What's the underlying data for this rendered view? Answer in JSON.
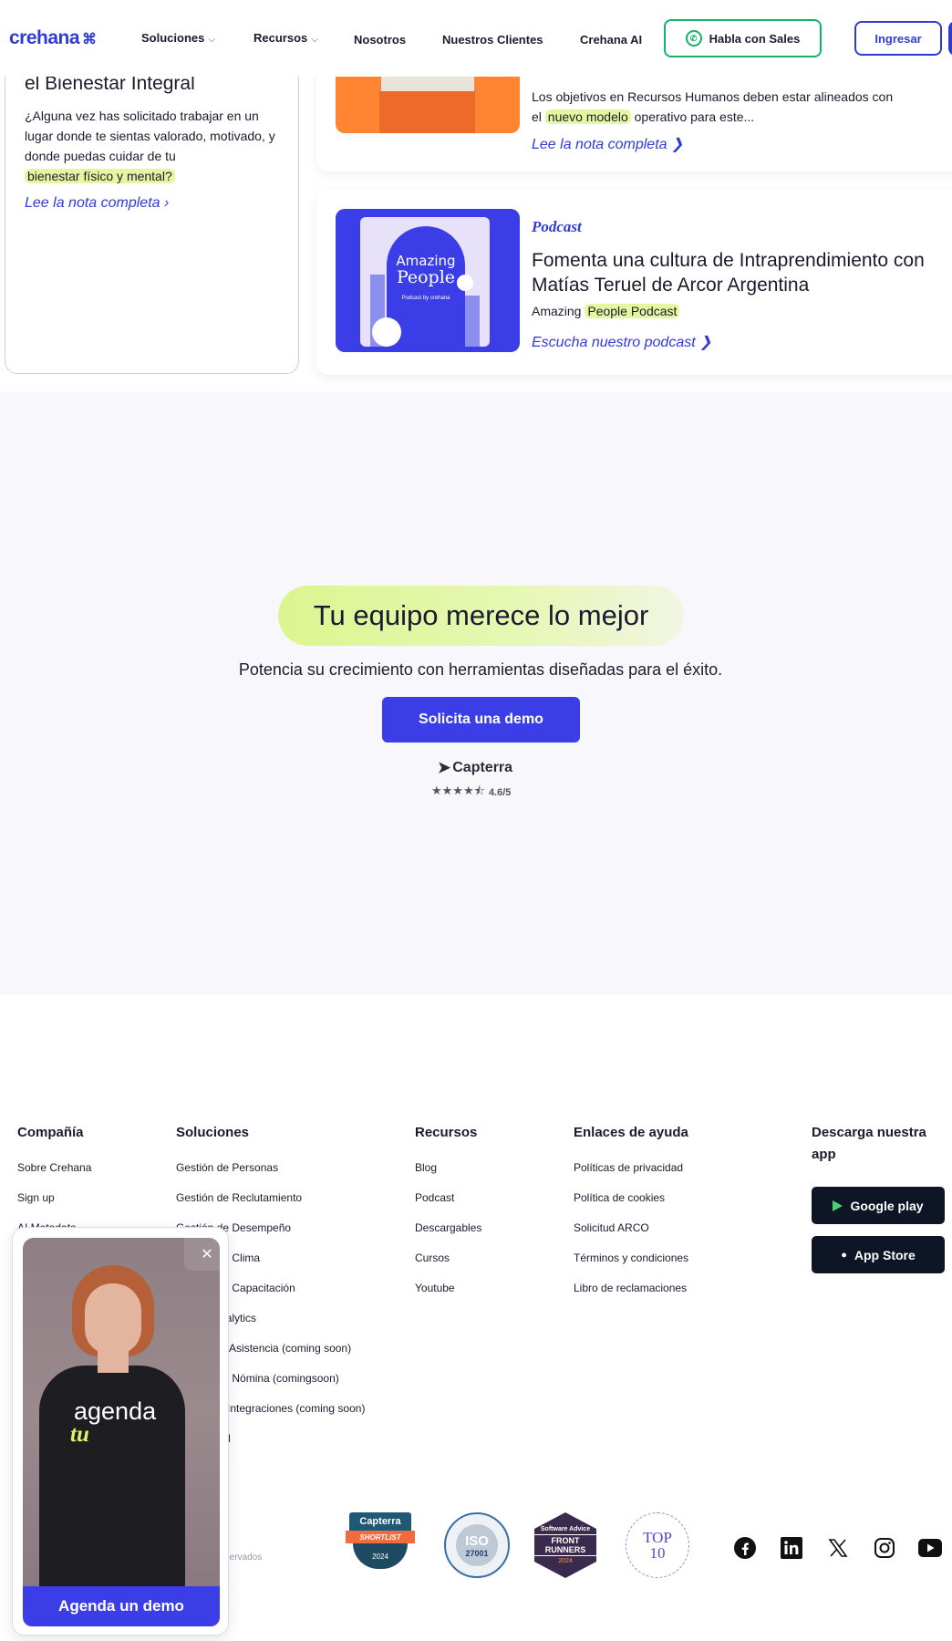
{
  "nav": {
    "logo": "crehana",
    "logo_mark": "⌘",
    "items": [
      {
        "label": "Soluciones",
        "has_dropdown": true
      },
      {
        "label": "Recursos",
        "has_dropdown": true
      },
      {
        "label": "Nosotros",
        "has_dropdown": false
      },
      {
        "label": "Nuestros Clientes",
        "has_dropdown": false
      },
      {
        "label": "Crehana AI",
        "has_dropdown": false
      }
    ],
    "sales_button": "Habla con Sales",
    "login_button": "Ingresar"
  },
  "articles": {
    "left": {
      "title": "el Bienestar Integral",
      "desc_lines": [
        "¿Alguna vez has solicitado trabajar en un",
        "lugar donde te sientas valorado, motivado, y",
        "donde puedas cuidar de tu"
      ],
      "desc_highlight": "bienestar físico y mental?",
      "link": "Lee la nota completa ›"
    },
    "right1": {
      "desc_line1": "Los objetivos en Recursos Humanos deben estar alineados con",
      "desc_prefix": "el ",
      "desc_highlight": "nuevo modelo",
      "desc_suffix": " operativo para este...",
      "link": "Lee la nota completa ❯"
    },
    "right2": {
      "tag": "Podcast",
      "title": "Fomenta una cultura de Intraprendimiento con Matías Teruel de Arcor Argentina",
      "desc_prefix": "Amazing ",
      "desc_highlight": "People Podcast",
      "link": "Escucha nuestro podcast ❯",
      "thumb_line1": "Amazing",
      "thumb_line2": "People",
      "thumb_sub": "Podcast by crehana"
    }
  },
  "cta": {
    "headline": "Tu equipo merece lo mejor",
    "subtitle": "Potencia su crecimiento con herramientas diseñadas para el éxito.",
    "button": "Solicita una demo",
    "capterra": "Capterra",
    "stars": "★★★★⯪",
    "rating": "4.6/5",
    "rating_value": 4.6
  },
  "footer": {
    "columns": [
      {
        "heading": "Compañía",
        "items": [
          "Sobre Crehana",
          "Sign up",
          "AI Metadata"
        ]
      },
      {
        "heading": "Soluciones",
        "items": [
          "Gestión de Personas",
          "Gestión de Reclutamiento",
          "Gestión de Desempeño",
          "Gestión de Clima",
          "Gestión de Capacitación",
          "People Analytics",
          "Control de Asistencia (coming soon)",
          "Gestión de Nómina (comingsoon)",
          "Centro de Integraciones (coming soon)",
          "Crehana AI"
        ]
      },
      {
        "heading": "Recursos",
        "items": [
          "Blog",
          "Podcast",
          "Descargables",
          "Cursos",
          "Youtube"
        ]
      },
      {
        "heading": "Enlaces de ayuda",
        "items": [
          "Políticas de privacidad",
          "Política de cookies",
          "Solicitud ARCO",
          "Términos y condiciones",
          "Libro de reclamaciones"
        ]
      }
    ],
    "download_heading": "Descarga nuestra app",
    "google_play": "Google play",
    "app_store": "App Store",
    "copyright": "s reservados",
    "badges": {
      "capterra_top": "Capterra",
      "capterra_mid": "SHORTLIST",
      "capterra_year": "2024",
      "iso_a": "ISO",
      "iso_b": "27001",
      "sa_a": "Software Advice",
      "sa_b": "FRONT RUNNERS",
      "sa_c": "2024",
      "top_a": "TOP",
      "top_b": "10"
    },
    "social": [
      "facebook-icon",
      "linkedin-icon",
      "x-icon",
      "instagram-icon",
      "youtube-icon"
    ]
  },
  "video_widget": {
    "overlay_line1": "agenda",
    "overlay_line2": "tu",
    "close": "✕",
    "button": "Agenda un demo"
  },
  "colors": {
    "brand": "#2f3bd9",
    "cta_button": "#3b3de6",
    "highlight": "#e4f7a0",
    "whatsapp": "#12b36b"
  }
}
